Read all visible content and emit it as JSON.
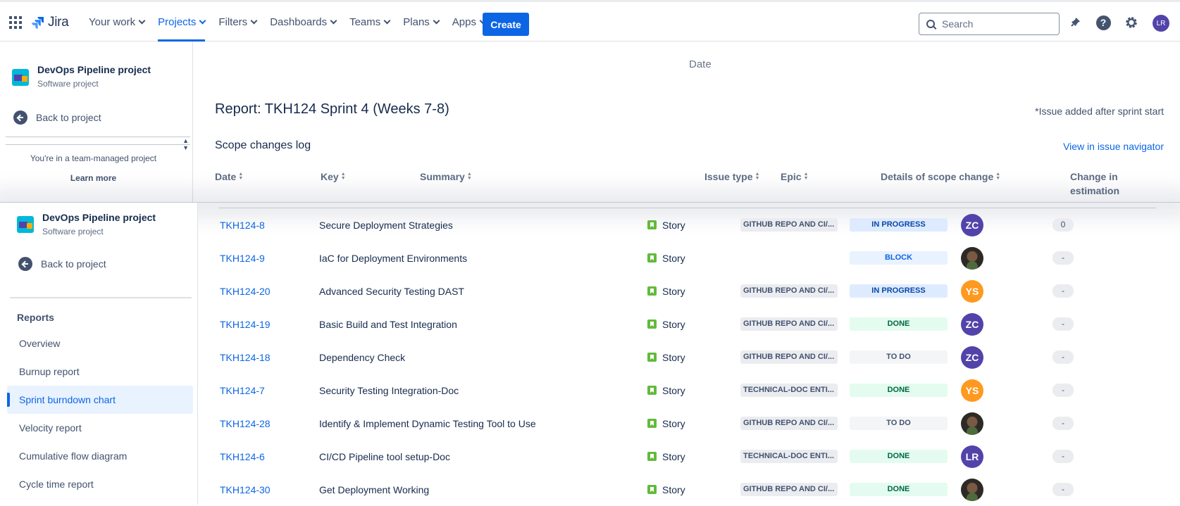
{
  "nav": {
    "logo_text": "Jira",
    "items": [
      {
        "label": "Your work",
        "active": false
      },
      {
        "label": "Projects",
        "active": true
      },
      {
        "label": "Filters",
        "active": false
      },
      {
        "label": "Dashboards",
        "active": false
      },
      {
        "label": "Teams",
        "active": false
      },
      {
        "label": "Plans",
        "active": false
      },
      {
        "label": "Apps",
        "active": false
      }
    ],
    "create_label": "Create",
    "search_placeholder": "Search",
    "avatar_initials": "LR",
    "accent_color": "#0c66e4"
  },
  "project": {
    "name": "DevOps Pipeline project",
    "type": "Software project",
    "back_label": "Back to project",
    "team_note": "You're in a team-managed project",
    "learn_more": "Learn more"
  },
  "report": {
    "date_label": "Date",
    "title": "Report: TKH124 Sprint 4 (Weeks 7-8)",
    "sprint_note": "*Issue added after sprint start",
    "section_title": "Scope changes log",
    "view_link": "View in issue navigator",
    "columns": {
      "date": "Date",
      "key": "Key",
      "summary": "Summary",
      "issue_type": "Issue type",
      "epic": "Epic",
      "details": "Details of scope change",
      "change_line1": "Change in",
      "change_line2": "estimation"
    }
  },
  "sidebar": {
    "reports_heading": "Reports",
    "items": [
      {
        "label": "Overview",
        "selected": false
      },
      {
        "label": "Burnup report",
        "selected": false
      },
      {
        "label": "Sprint burndown chart",
        "selected": true
      },
      {
        "label": "Velocity report",
        "selected": false
      },
      {
        "label": "Cumulative flow diagram",
        "selected": false
      },
      {
        "label": "Cycle time report",
        "selected": false
      }
    ]
  },
  "rows": [
    {
      "key": "TKH124-8",
      "summary": "Secure Deployment Strategies",
      "type": "Story",
      "epic": "GITHUB REPO AND CI/...",
      "status": "IN PROGRESS",
      "status_class": "st-inprogress",
      "assignee": "ZC",
      "assignee_color": "#5243aa",
      "photo": false,
      "est": "0"
    },
    {
      "key": "TKH124-9",
      "summary": "IaC for Deployment Environments",
      "type": "Story",
      "epic": "",
      "status": "BLOCK",
      "status_class": "st-block",
      "assignee": "",
      "assignee_color": "",
      "photo": true,
      "est": "-"
    },
    {
      "key": "TKH124-20",
      "summary": "Advanced Security Testing DAST",
      "type": "Story",
      "epic": "GITHUB REPO AND CI/...",
      "status": "IN PROGRESS",
      "status_class": "st-inprogress",
      "assignee": "YS",
      "assignee_color": "#ff991f",
      "photo": false,
      "est": "-"
    },
    {
      "key": "TKH124-19",
      "summary": "Basic Build and Test Integration",
      "type": "Story",
      "epic": "GITHUB REPO AND CI/...",
      "status": "DONE",
      "status_class": "st-done",
      "assignee": "ZC",
      "assignee_color": "#5243aa",
      "photo": false,
      "est": "-"
    },
    {
      "key": "TKH124-18",
      "summary": "Dependency Check",
      "type": "Story",
      "epic": "GITHUB REPO AND CI/...",
      "status": "TO DO",
      "status_class": "st-todo",
      "assignee": "ZC",
      "assignee_color": "#5243aa",
      "photo": false,
      "est": "-"
    },
    {
      "key": "TKH124-7",
      "summary": "Security Testing Integration-Doc",
      "type": "Story",
      "epic": "TECHNICAL-DOC ENTI...",
      "status": "DONE",
      "status_class": "st-done",
      "assignee": "YS",
      "assignee_color": "#ff991f",
      "photo": false,
      "est": "-"
    },
    {
      "key": "TKH124-28",
      "summary": "Identify & Implement Dynamic Testing Tool to Use",
      "type": "Story",
      "epic": "GITHUB REPO AND CI/...",
      "status": "TO DO",
      "status_class": "st-todo",
      "assignee": "",
      "assignee_color": "",
      "photo": true,
      "est": "-"
    },
    {
      "key": "TKH124-6",
      "summary": "CI/CD Pipeline tool setup-Doc",
      "type": "Story",
      "epic": "TECHNICAL-DOC ENTI...",
      "status": "DONE",
      "status_class": "st-done",
      "assignee": "LR",
      "assignee_color": "#5243aa",
      "photo": false,
      "est": "-"
    },
    {
      "key": "TKH124-30",
      "summary": "Get Deployment Working",
      "type": "Story",
      "epic": "GITHUB REPO AND CI/...",
      "status": "DONE",
      "status_class": "st-done",
      "assignee": "",
      "assignee_color": "",
      "photo": true,
      "est": "-"
    }
  ]
}
